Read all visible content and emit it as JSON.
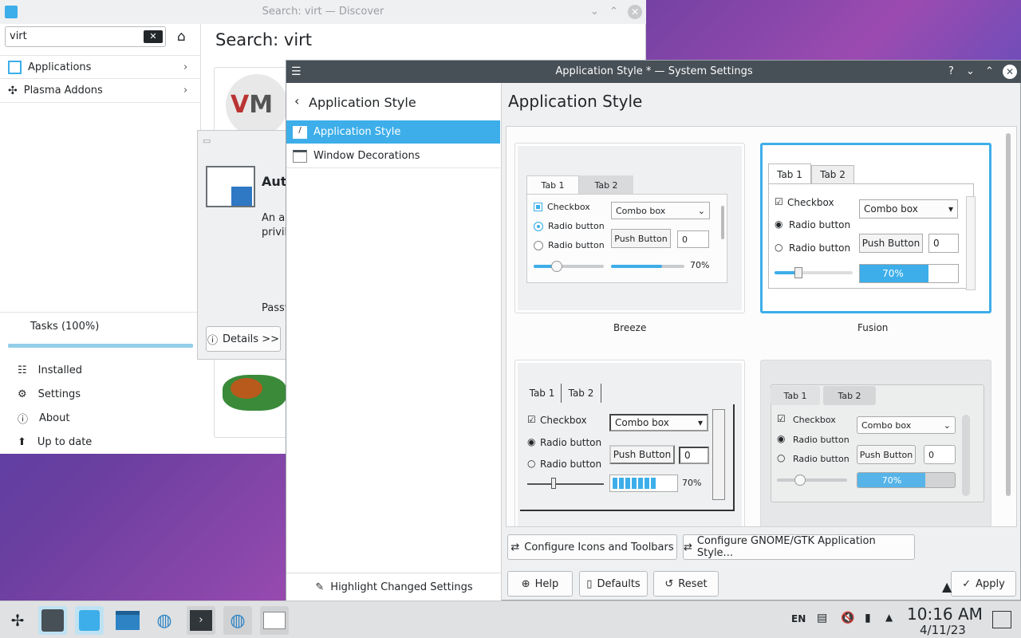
{
  "discover": {
    "title": "Search: virt — Discover",
    "search_value": "virt",
    "heading": "Search: virt",
    "nav": [
      {
        "label": "Applications"
      },
      {
        "label": "Plasma Addons"
      }
    ],
    "tasks": "Tasks (100%)",
    "tasks_progress": 1.0,
    "bottom": [
      {
        "label": "Installed"
      },
      {
        "label": "Settings"
      },
      {
        "label": "About"
      },
      {
        "label": "Up to date"
      }
    ]
  },
  "auth": {
    "title_partial": "Auth",
    "line1": "An ap",
    "line2": "privil",
    "pass": "Passw",
    "details": "Details >>"
  },
  "settings": {
    "title": "Application Style * — System Settings",
    "back_label": "Application Style",
    "page_title": "Application Style",
    "sidebar": [
      {
        "label": "Application Style"
      },
      {
        "label": "Window Decorations"
      }
    ],
    "highlight": "Highlight Changed Settings",
    "configure_icons": "Configure Icons and Toolbars",
    "configure_gtk": "Configure GNOME/GTK Application Style...",
    "help": "Help",
    "defaults": "Defaults",
    "reset": "Reset",
    "apply": "Apply"
  },
  "preview": {
    "tab1": "Tab 1",
    "tab2": "Tab 2",
    "checkbox": "Checkbox",
    "radio": "Radio button",
    "combo": "Combo box",
    "push": "Push Button",
    "spin": "0",
    "pct": "70%",
    "styles": [
      {
        "name": "Breeze"
      },
      {
        "name": "Fusion"
      }
    ]
  },
  "tray": {
    "lang": "EN",
    "time": "10:16 AM",
    "date": "4/11/23"
  },
  "colors": {
    "accent": "#3daee9",
    "titlebar": "#475057"
  }
}
